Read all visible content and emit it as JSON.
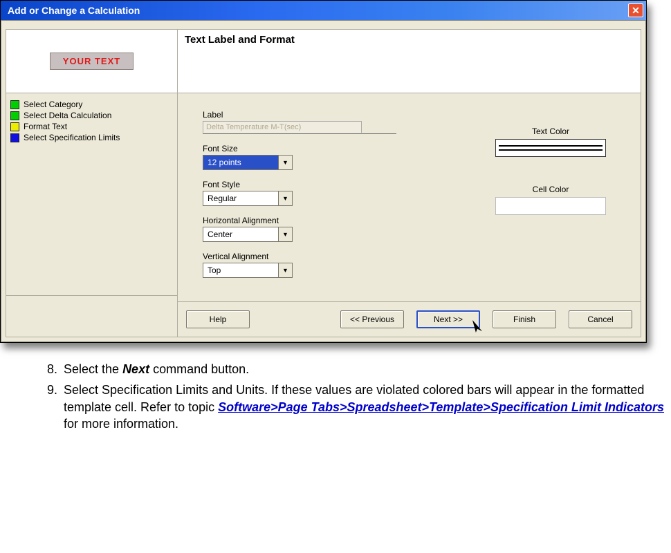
{
  "dialog": {
    "title": "Add or Change a Calculation",
    "close_glyph": "✕"
  },
  "preview": {
    "text": "YOUR TEXT"
  },
  "steps": [
    {
      "label": "Select Category",
      "color": "green"
    },
    {
      "label": "Select Delta Calculation",
      "color": "green"
    },
    {
      "label": "Format Text",
      "color": "yellow"
    },
    {
      "label": "Select Specification Limits",
      "color": "blue"
    }
  ],
  "section": {
    "title": "Text Label and Format"
  },
  "fields": {
    "label_caption": "Label",
    "label_value": "Delta Temperature M-T(sec)",
    "font_size_caption": "Font Size",
    "font_size_value": "12 points",
    "font_style_caption": "Font Style",
    "font_style_value": "Regular",
    "halign_caption": "Horizontal Alignment",
    "halign_value": "Center",
    "valign_caption": "Vertical Alignment",
    "valign_value": "Top",
    "text_color_caption": "Text Color",
    "cell_color_caption": "Cell Color",
    "combo_arrow": "▼"
  },
  "buttons": {
    "help": "Help",
    "prev": "<< Previous",
    "next": "Next >>",
    "finish": "Finish",
    "cancel": "Cancel"
  },
  "instructions": {
    "item8_num": "8)",
    "item8_a": "Select the ",
    "item8_b": "Next",
    "item8_c": " command button.",
    "item9_num": "9)",
    "item9_a": "Select Specification Limits and Units. If these values are violated colored bars will appear in the formatted template cell. Refer to   topic ",
    "item9_link": "Software>Page Tabs>Spreadsheet>Template>Specification Limit Indicators",
    "item9_b": " for more information."
  }
}
